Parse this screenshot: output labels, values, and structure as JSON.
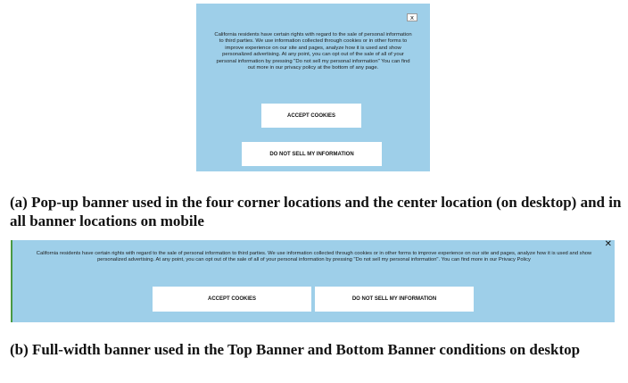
{
  "popup": {
    "close_label": "x",
    "body_text": "California residents have certain rights with regard to the sale of personal information to third parties. We use information collected through cookies or in other forms to improve experience on our site and pages, analyze how it is used and show personalized advertising. At any point, you can opt out of the sale of all of your personal information by pressing \"Do not sell my personal information\" You can find out more in our privacy policy at the bottom of any page.",
    "accept_label": "ACCEPT COOKIES",
    "do_not_sell_label": "DO NOT SELL MY INFORMATION"
  },
  "caption_a": "(a) Pop-up banner used in the four corner locations and the center location (on desktop) and in all banner locations on mobile",
  "full_banner": {
    "close_label": "✕",
    "body_text": "California residents have certain rights with regard to the sale of personal information to third parties. We use information collected through cookies or in other forms to improve experience on our site and pages, analyze how it is used and show personalized advertising. At any point, you can opt out of the sale of all of your personal information by pressing \"Do not sell my personal information\". You can find more in our Privacy Policy",
    "accept_label": "ACCEPT COOKIES",
    "do_not_sell_label": "DO NOT SELL MY INFORMATION"
  },
  "caption_b": "(b) Full-width banner used in the Top Banner and Bottom Banner conditions on desktop",
  "colors": {
    "banner_background": "#9ecfe9",
    "button_background": "#ffffff"
  }
}
